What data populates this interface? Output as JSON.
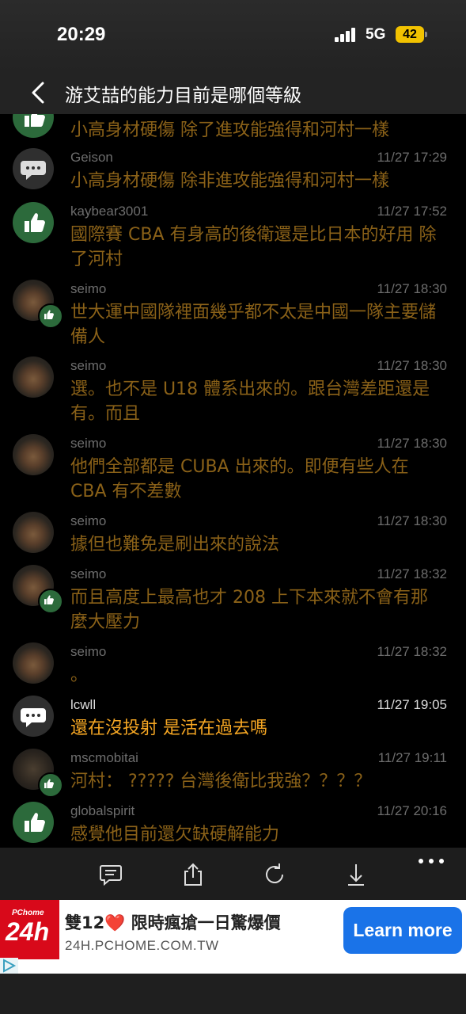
{
  "status": {
    "time": "20:29",
    "network": "5G",
    "battery": "42"
  },
  "nav": {
    "title": "游艾喆的能力目前是哪個等級"
  },
  "comments": [
    {
      "avatar": "like",
      "author": "",
      "time": "",
      "text": "小高身材硬傷 除了進攻能強得和河村一樣"
    },
    {
      "avatar": "chat",
      "author": "Geison",
      "time": "11/27 17:29",
      "text": "小高身材硬傷 除非進攻能強得和河村一樣"
    },
    {
      "avatar": "like",
      "author": "kaybear3001",
      "time": "11/27 17:52",
      "text": "國際賽 CBA 有身高的後衛還是比日本的好用 除了河村"
    },
    {
      "avatar": "photo",
      "author": "seimo",
      "time": "11/27 18:30",
      "text": "世大運中國隊裡面幾乎都不太是中國一隊主要儲備人"
    },
    {
      "avatar": "photo",
      "author": "seimo",
      "time": "11/27 18:30",
      "text": "選。也不是 U18 體系出來的。跟台灣差距還是有。而且"
    },
    {
      "avatar": "photo",
      "author": "seimo",
      "time": "11/27 18:30",
      "text": "他們全部都是 CUBA 出來的。即便有些人在 CBA 有不差數"
    },
    {
      "avatar": "photo",
      "author": "seimo",
      "time": "11/27 18:30",
      "text": "據但也難免是刷出來的說法"
    },
    {
      "avatar": "photo",
      "author": "seimo",
      "time": "11/27 18:32",
      "text": "而且高度上最高也才 208 上下本來就不會有那麼大壓力"
    },
    {
      "avatar": "photo",
      "author": "seimo",
      "time": "11/27 18:32",
      "text": "。"
    },
    {
      "avatar": "chat",
      "author": "lcwll",
      "time": "11/27 19:05",
      "text": "還在沒投射 是活在過去嗎"
    },
    {
      "avatar": "photo2",
      "author": "mscmobitai",
      "time": "11/27 19:11",
      "text": "河村： ????? 台灣後衛比我強？？？？"
    },
    {
      "avatar": "like",
      "author": "globalspirit",
      "time": "11/27 20:16",
      "text": "感覺他目前還欠缺硬解能力"
    }
  ],
  "toolbar": {
    "icons": [
      "comment-icon",
      "share-icon",
      "refresh-icon",
      "download-icon",
      "more-icon"
    ]
  },
  "ad": {
    "logo_top": "PChome",
    "logo_main": "24h",
    "headline": "雙12❤️ 限時瘋搶一日驚爆價",
    "url": "24H.PCHOME.COM.TW",
    "cta": "Learn more"
  },
  "colors": {
    "like_green": "#2c6a3b",
    "comment_text": "#8a6118",
    "highlight_text": "#f5a623",
    "cta_blue": "#1a73e8"
  }
}
